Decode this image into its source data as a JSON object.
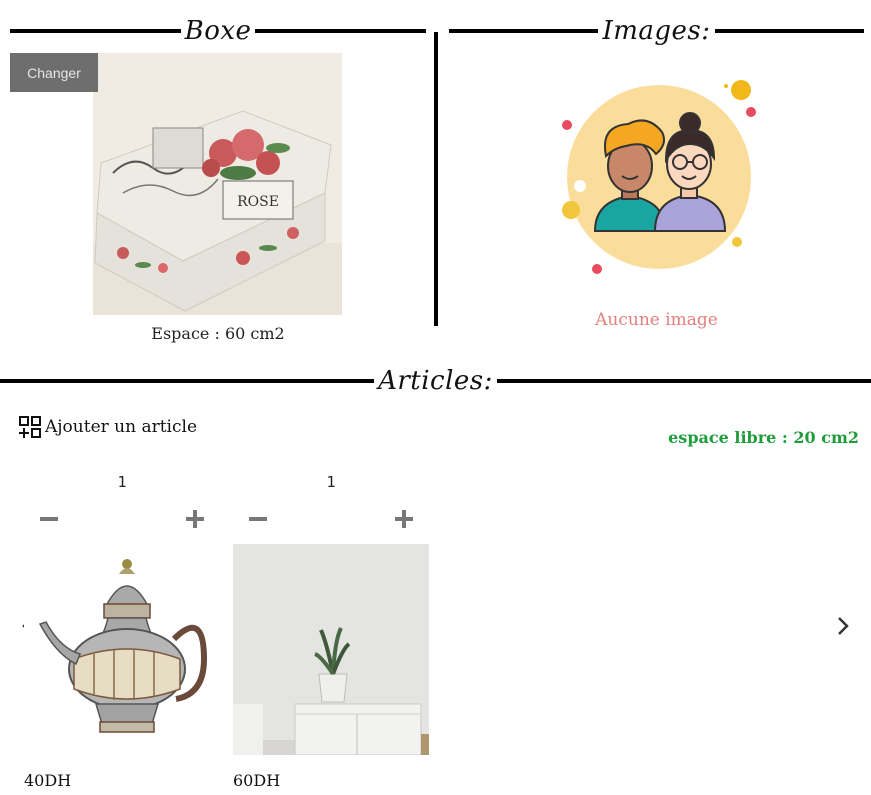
{
  "boxe": {
    "title": "Boxe",
    "change_label": "Changer",
    "space_text": "Espace : 60 cm2"
  },
  "images": {
    "title": "Images:",
    "empty_text": "Aucune image"
  },
  "articles": {
    "title": "Articles:",
    "add_label": "Ajouter un article",
    "free_space_text": "espace libre : 20 cm2",
    "items": [
      {
        "quantity": "1",
        "price": "40DH",
        "image": "teapot"
      },
      {
        "quantity": "1",
        "price": "60DH",
        "image": "plant-on-cabinet"
      }
    ]
  },
  "colors": {
    "no_image_text": "#e77e7e",
    "free_space_text": "#1f9d3a",
    "change_button_bg": "#6e6e6e"
  },
  "icons": {
    "add": "add-grid-icon",
    "prev": "chevron-left-icon",
    "next": "chevron-right-icon",
    "minus": "minus-icon",
    "plus": "plus-icon"
  }
}
